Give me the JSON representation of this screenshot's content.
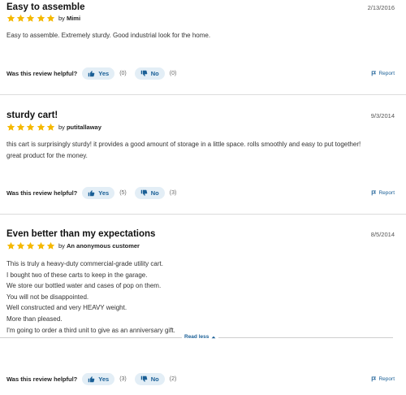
{
  "helpful_prompt": "Was this review helpful?",
  "yes_label": "Yes",
  "no_label": "No",
  "report_label": "Report",
  "by_prefix": "by",
  "read_less_label": "Read less",
  "star_color": "#f5b800",
  "link_color": "#1a5f96",
  "reviews": [
    {
      "title": "Easy to assemble",
      "date": "2/13/2016",
      "rating": 5,
      "author": "Mimi",
      "lines": [
        "Easy to assemble. Extremely sturdy. Good industrial look for the home."
      ],
      "yes_count": "(0)",
      "no_count": "(0)"
    },
    {
      "title": "sturdy cart!",
      "date": "9/3/2014",
      "rating": 5,
      "author": "putitallaway",
      "lines": [
        "this cart is surprisingly sturdy! it provides a good amount of storage in a little space. rolls smoothly and easy to put together!",
        "great product for the money."
      ],
      "yes_count": "(5)",
      "no_count": "(3)"
    },
    {
      "title": "Even better than my expectations",
      "date": "8/5/2014",
      "rating": 5,
      "author": "An anonymous customer",
      "lines": [
        "This is truly a heavy-duty commercial-grade utility cart.",
        "I bought two of these carts to keep in the garage.",
        "We store our bottled water and cases of pop on them.",
        "You will not be disappointed.",
        "Well constructed and very HEAVY weight.",
        "More than pleased.",
        "I'm going to order a third unit to give as an anniversary gift."
      ],
      "yes_count": "(3)",
      "no_count": "(2)"
    }
  ]
}
